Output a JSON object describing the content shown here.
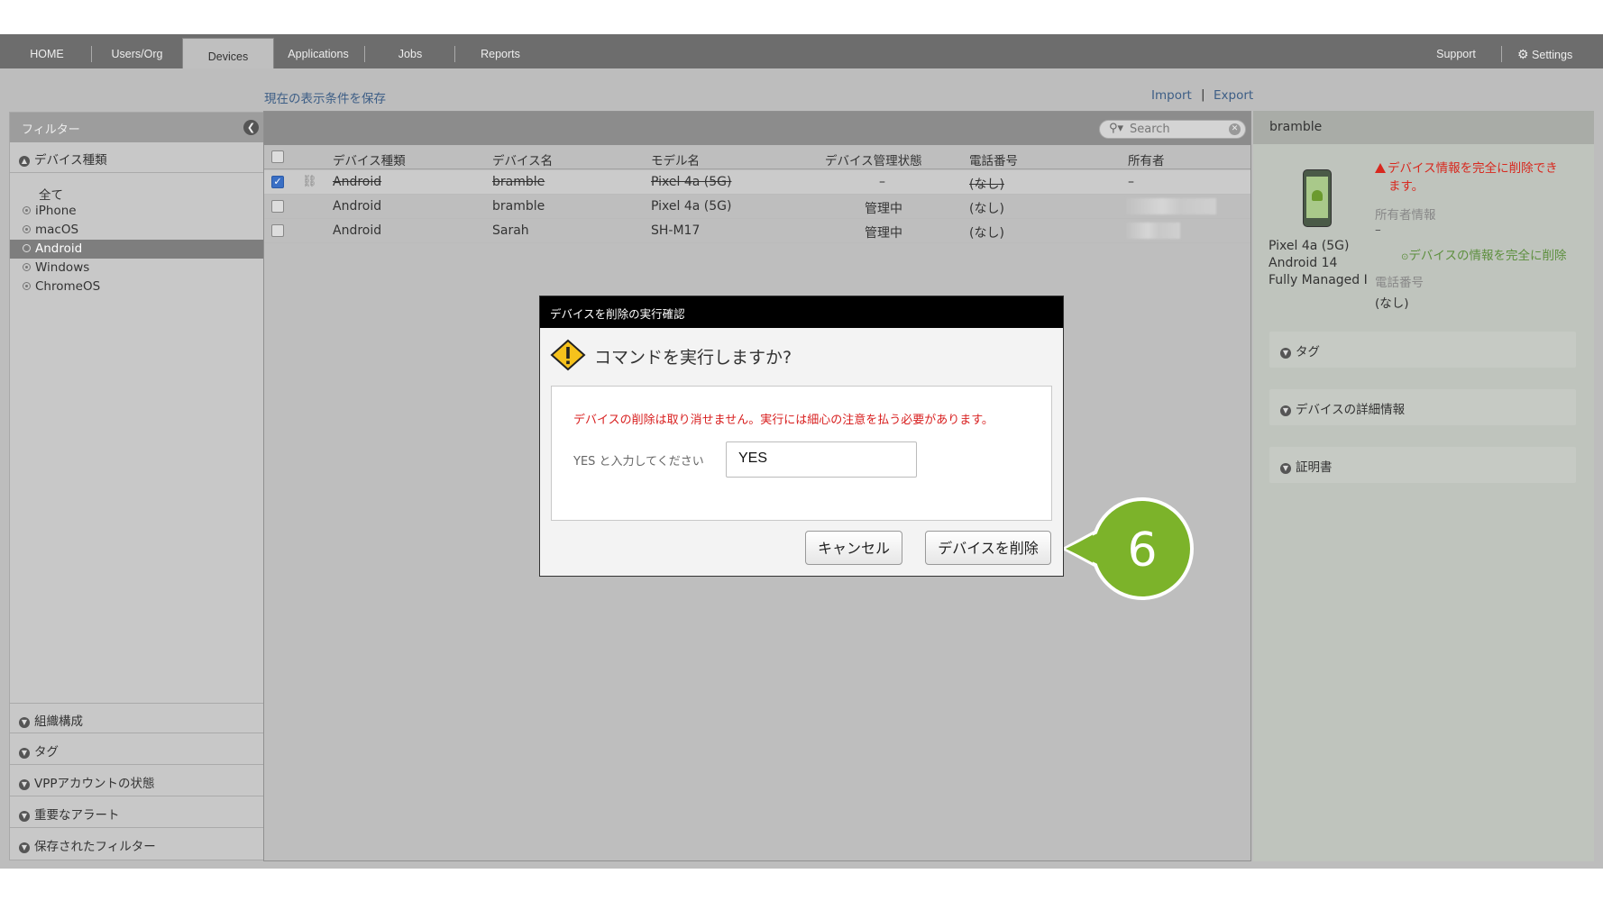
{
  "nav": {
    "tabs": [
      "HOME",
      "Users/Org",
      "Devices",
      "Applications",
      "Jobs",
      "Reports"
    ],
    "support": "Support",
    "settings": "Settings"
  },
  "links": {
    "save_view": "現在の表示条件を保存",
    "import": "Import",
    "sep": "|",
    "export": "Export"
  },
  "filter": {
    "header": "フィルター",
    "device_type": "デバイス種類",
    "items": [
      "全て",
      "iPhone",
      "macOS",
      "Android",
      "Windows",
      "ChromeOS"
    ],
    "selected": "Android",
    "sections": [
      "組織構成",
      "タグ",
      "VPPアカウントの状態",
      "重要なアラート",
      "保存されたフィルター"
    ]
  },
  "search": {
    "placeholder": "Search"
  },
  "table": {
    "columns": [
      "デバイス種類",
      "デバイス名",
      "モデル名",
      "デバイス管理状態",
      "電話番号",
      "所有者"
    ],
    "rows": [
      {
        "type": "Android",
        "name": "bramble",
        "model": "Pixel 4a (5G)",
        "status": "–",
        "phone": "(なし)",
        "owner": "–",
        "checked": true,
        "deleted": true
      },
      {
        "type": "Android",
        "name": "bramble",
        "model": "Pixel 4a (5G)",
        "status": "管理中",
        "phone": "(なし)",
        "owner": "",
        "checked": false,
        "deleted": false
      },
      {
        "type": "Android",
        "name": "Sarah",
        "model": "SH-M17",
        "status": "管理中",
        "phone": "(なし)",
        "owner": "",
        "checked": false,
        "deleted": false
      }
    ]
  },
  "detail": {
    "title": "bramble",
    "warning_line1": "デバイス情報を完全に削除でき",
    "warning_line2": "ます。",
    "owner_label": "所有者情報",
    "owner_value": "–",
    "delete_link": "デバイスの情報を完全に削除",
    "phone_label": "電話番号",
    "phone_value": "(なし)",
    "model": "Pixel 4a (5G)",
    "os": "Android 14",
    "mode": "Fully Managed I",
    "sections": [
      "タグ",
      "デバイスの詳細情報",
      "証明書"
    ]
  },
  "dialog": {
    "title": "デバイスを削除の実行確認",
    "question": "コマンドを実行しますか?",
    "warning": "デバイスの削除は取り消せません。実行には細心の注意を払う必要があります。",
    "input_label": "YES と入力してください",
    "input_value": "YES",
    "cancel": "キャンセル",
    "confirm": "デバイスを削除"
  },
  "callout": {
    "step": "6"
  },
  "colors": {
    "callout": "#7cb32a",
    "warning": "#d81f1f",
    "link": "#3d5e86",
    "selected_check": "#3a6fc4"
  }
}
